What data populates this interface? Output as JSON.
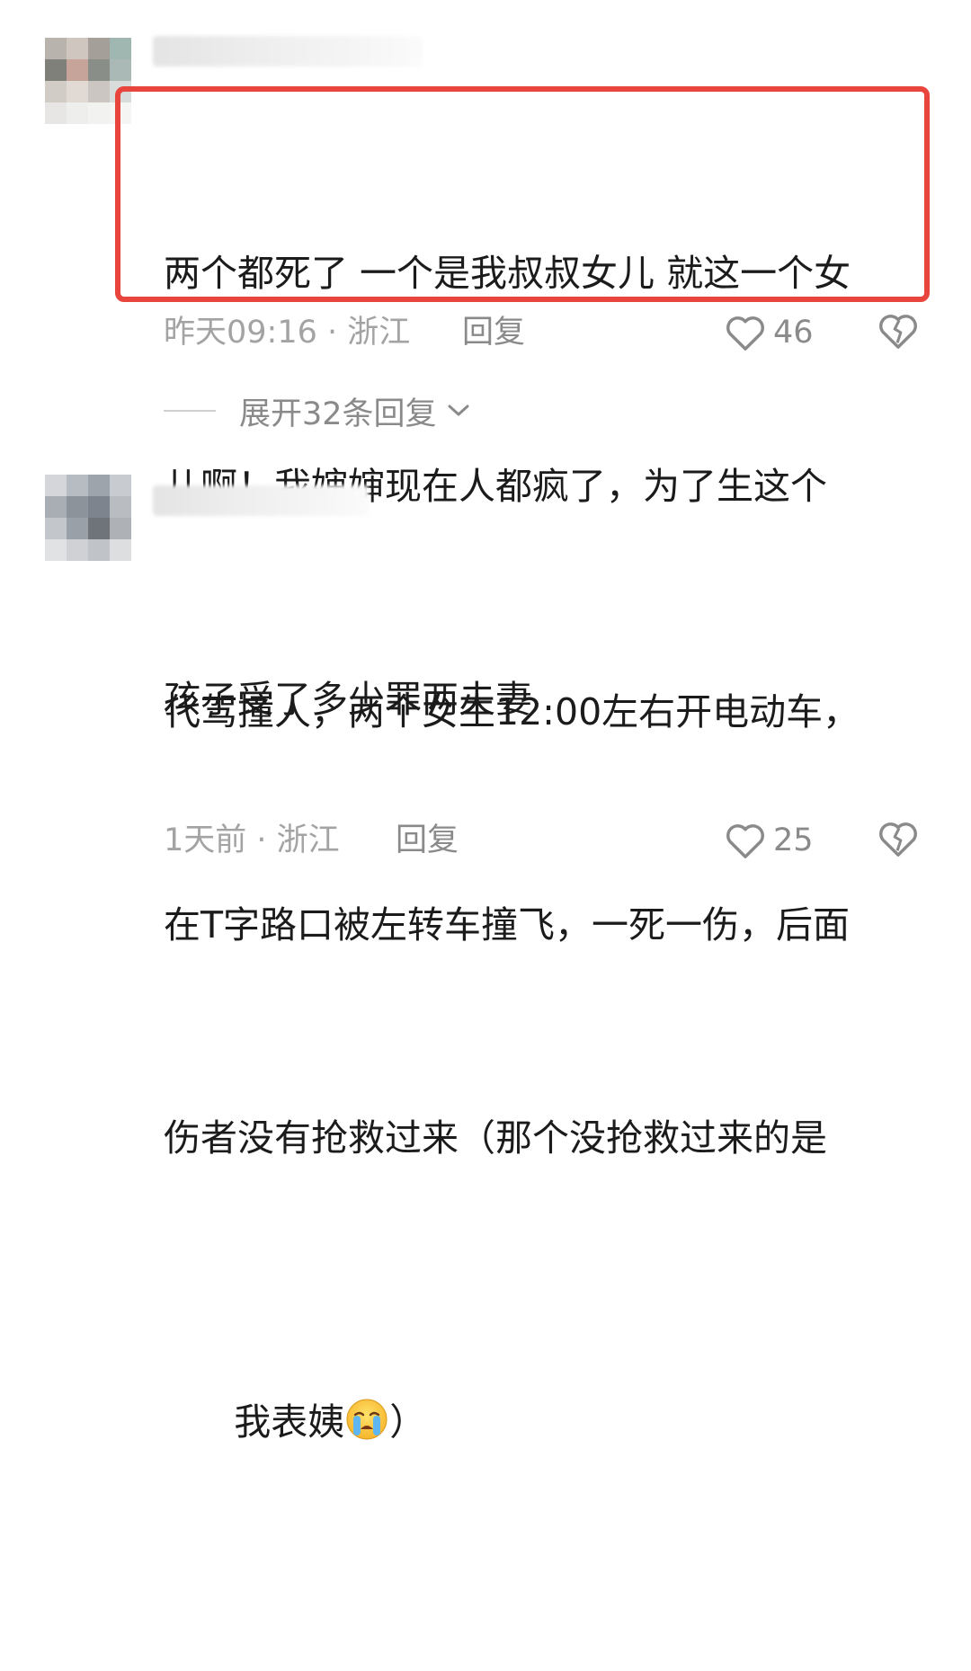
{
  "comments": [
    {
      "text_lines": [
        "两个都死了 一个是我叔叔女儿 就这一个女",
        "儿啊！我婶婶现在人都疯了，为了生这个",
        "孩子受了多少罪两夫妻"
      ],
      "time_location": "昨天09:16 · 浙江",
      "reply_label": "回复",
      "likes": "46",
      "highlighted": true,
      "highlight_color": "#e8453c"
    },
    {
      "text_lines": [
        "代驾撞人，两个女生12:00左右开电动车，",
        "在T字路口被左转车撞飞，一死一伤，后面",
        "伤者没有抢救过来（那个没抢救过来的是"
      ],
      "last_line_prefix": "我表姨",
      "last_line_suffix": "）",
      "emoji": "crying-face-emoji",
      "time_location": "1天前 · 浙江",
      "reply_label": "回复",
      "likes": "25"
    }
  ],
  "expand_replies": {
    "label": "展开32条回复",
    "icon": "chevron-down-icon"
  }
}
